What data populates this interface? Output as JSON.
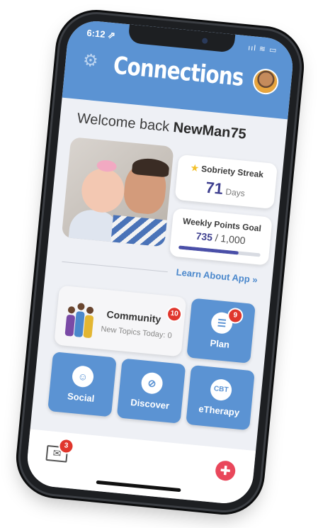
{
  "status": {
    "time": "6:12 ⇗",
    "icons": "ııl ≋ ▭"
  },
  "header": {
    "title": "Connections"
  },
  "welcome": {
    "prefix": "Welcome back",
    "username": "NewMan75"
  },
  "streak": {
    "title": "Sobriety Streak",
    "value": "71",
    "unit": "Days"
  },
  "points": {
    "title": "Weekly Points Goal",
    "current": "735",
    "separator": " / ",
    "goal": "1,000",
    "progress": 0.735
  },
  "learn_link": "Learn About App »",
  "community": {
    "label": "Community",
    "badge": "10",
    "subtitle": "New Topics Today: 0"
  },
  "tiles": {
    "plan": {
      "label": "Plan",
      "badge": "9",
      "icon": "☰"
    },
    "social": {
      "label": "Social",
      "icon": "☺"
    },
    "discover": {
      "label": "Discover",
      "icon": "⊘"
    },
    "therapy": {
      "label": "eTherapy",
      "icon": "CBT"
    }
  },
  "bottom": {
    "mail_badge": "3",
    "mail_icon": "✉",
    "help_icon": "✚"
  },
  "colors": {
    "brand_blue": "#5b93d3",
    "accent_purple": "#3e3f8f",
    "badge_red": "#e0362c"
  }
}
